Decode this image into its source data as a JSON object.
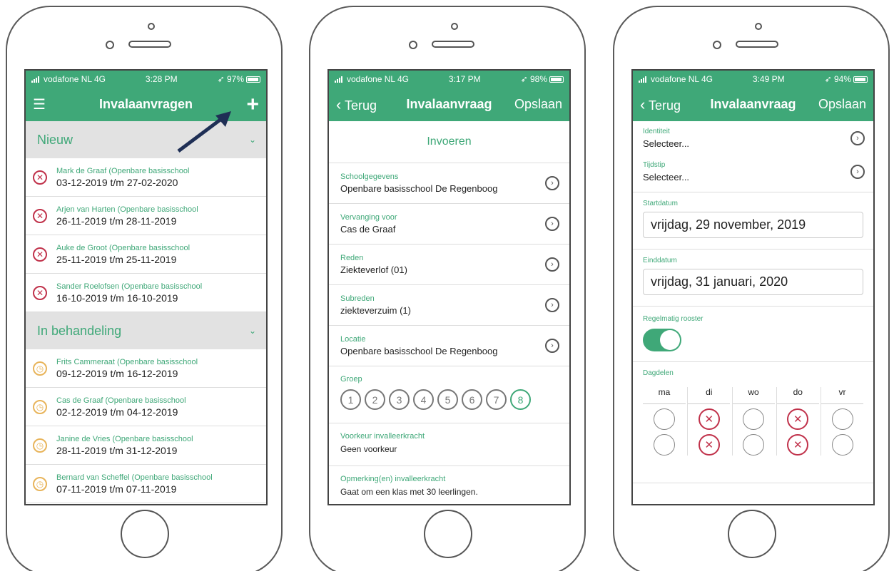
{
  "phones": [
    {
      "status": {
        "carrier": "vodafone NL 4G",
        "time": "3:28 PM",
        "battery": "97%"
      },
      "nav": {
        "title": "Invalaanvragen",
        "left_icon": "hamburger-menu-icon",
        "right_icon": "plus-icon"
      },
      "sections": [
        {
          "title": "Nieuw",
          "items": [
            {
              "name": "Mark de Graaf (Openbare basisschool",
              "dates": "03-12-2019 t/m 27-02-2020",
              "icon": "x-circle-icon"
            },
            {
              "name": "Arjen van Harten (Openbare basisschool",
              "dates": "26-11-2019 t/m 28-11-2019",
              "icon": "x-circle-icon"
            },
            {
              "name": "Auke de Groot (Openbare basisschool",
              "dates": "25-11-2019 t/m 25-11-2019",
              "icon": "x-circle-icon"
            },
            {
              "name": "Sander Roelofsen (Openbare basisschool",
              "dates": "16-10-2019 t/m 16-10-2019",
              "icon": "x-circle-icon"
            }
          ]
        },
        {
          "title": "In behandeling",
          "items": [
            {
              "name": "Frits Cammeraat (Openbare basisschool",
              "dates": "09-12-2019 t/m 16-12-2019",
              "icon": "clock-icon"
            },
            {
              "name": "Cas de Graaf (Openbare basisschool",
              "dates": "02-12-2019 t/m 04-12-2019",
              "icon": "clock-icon"
            },
            {
              "name": "Janine de Vries (Openbare basisschool",
              "dates": "28-11-2019 t/m 31-12-2019",
              "icon": "clock-icon"
            },
            {
              "name": "Bernard van Scheffel (Openbare basisschool",
              "dates": "07-11-2019 t/m 07-11-2019",
              "icon": "clock-icon"
            }
          ]
        }
      ]
    },
    {
      "status": {
        "carrier": "vodafone NL 4G",
        "time": "3:17 PM",
        "battery": "98%"
      },
      "nav": {
        "back": "Terug",
        "title": "Invalaanvraag",
        "save": "Opslaan"
      },
      "invoeren": "Invoeren",
      "fields": [
        {
          "label": "Schoolgegevens",
          "value": "Openbare basisschool De Regenboog"
        },
        {
          "label": "Vervanging voor",
          "value": "Cas de Graaf"
        },
        {
          "label": "Reden",
          "value": "Ziekteverlof (01)"
        },
        {
          "label": "Subreden",
          "value": "ziekteverzuim (1)"
        },
        {
          "label": "Locatie",
          "value": "Openbare basisschool De Regenboog"
        }
      ],
      "groep": {
        "label": "Groep",
        "options": [
          "1",
          "2",
          "3",
          "4",
          "5",
          "6",
          "7",
          "8"
        ],
        "selected": "8"
      },
      "voorkeur": {
        "label": "Voorkeur invalleerkracht",
        "value": "Geen voorkeur"
      },
      "opmerking": {
        "label": "Opmerking(en) invalleerkracht",
        "value": "Gaat om een klas met 30 leerlingen."
      }
    },
    {
      "status": {
        "carrier": "vodafone NL 4G",
        "time": "3:49 PM",
        "battery": "94%"
      },
      "nav": {
        "back": "Terug",
        "title": "Invalaanvraag",
        "save": "Opslaan"
      },
      "identiteit": {
        "label": "Identiteit",
        "value": "Selecteer..."
      },
      "tijdstip": {
        "label": "Tijdstip",
        "value": "Selecteer..."
      },
      "startdatum": {
        "label": "Startdatum",
        "value": "vrijdag, 29 november, 2019"
      },
      "einddatum": {
        "label": "Einddatum",
        "value": "vrijdag, 31 januari, 2020"
      },
      "regelmatig": {
        "label": "Regelmatig rooster",
        "on": true
      },
      "dagdelen": {
        "label": "Dagdelen",
        "days": [
          "ma",
          "di",
          "wo",
          "do",
          "vr"
        ],
        "selected": [
          [
            false,
            false
          ],
          [
            true,
            true
          ],
          [
            false,
            false
          ],
          [
            true,
            true
          ],
          [
            false,
            false
          ]
        ]
      }
    }
  ],
  "accent_color": "#3fa878",
  "error_color": "#c0314a",
  "pending_color": "#e8b45a"
}
